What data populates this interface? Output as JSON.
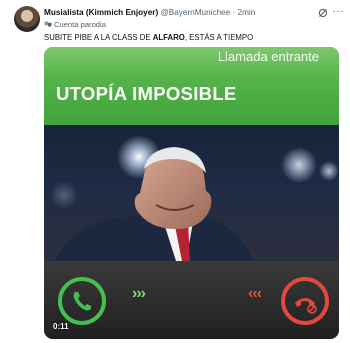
{
  "tweet": {
    "display_name": "Musialista (Kimmich Enjoyer)",
    "handle": "@BayernMunichee",
    "separator": "·",
    "time": "2min",
    "parody_label": "Cuenta parodia",
    "text_before": "SUBITE PIBE A LA CLASS DE ",
    "text_bold": "ALFARO",
    "text_after": ", ESTÁS A TIEMPO",
    "more_label": "···"
  },
  "media": {
    "call_status": "Llamada entrante",
    "caller_name": "UTOPÍA IMPOSIBLE",
    "accept_arrows": "›››",
    "decline_arrows": "‹‹‹",
    "video_duration": "0:11"
  },
  "colors": {
    "call_green": "#56b34a",
    "accept_green": "#43c04d",
    "decline_red": "#e14a3a"
  }
}
